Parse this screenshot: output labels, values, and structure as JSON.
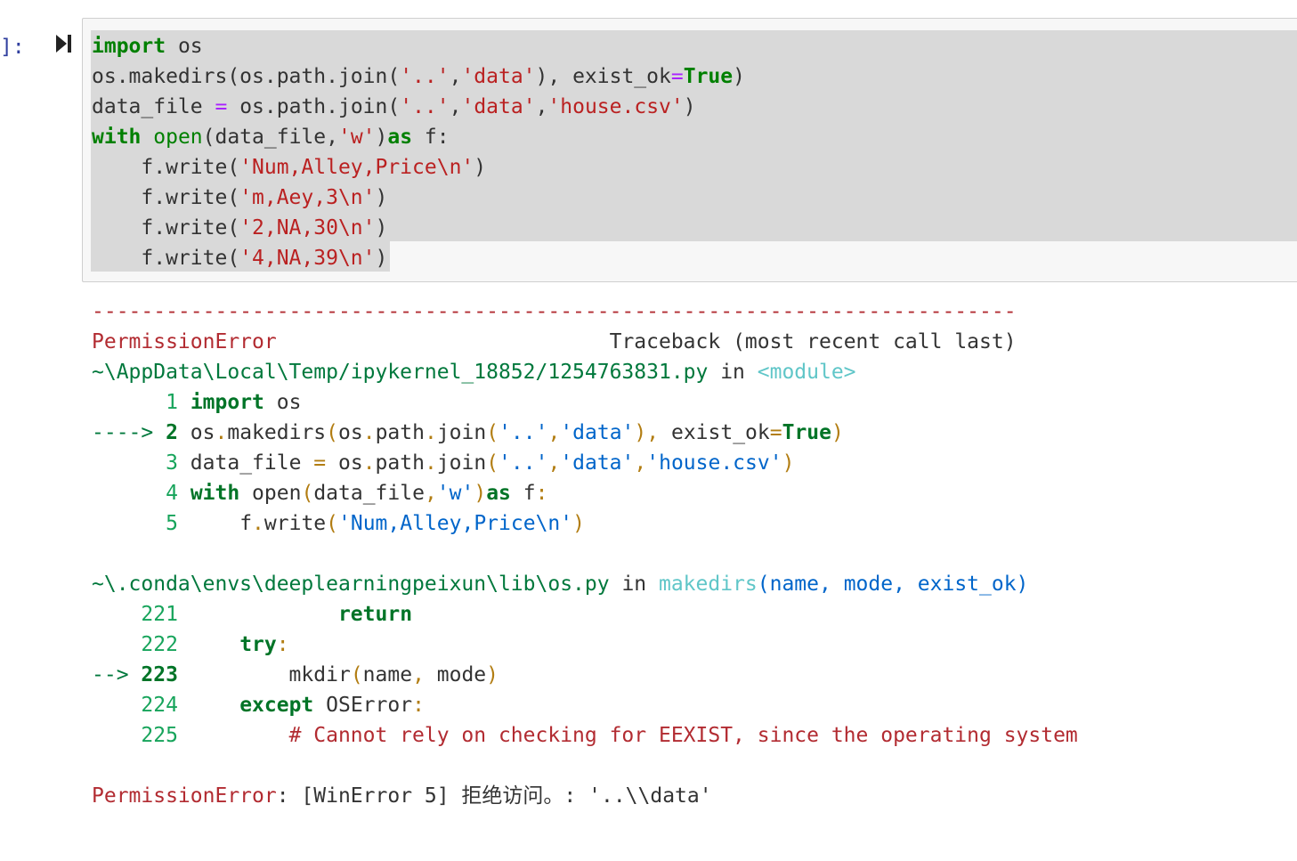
{
  "cell": {
    "prompt": "]:",
    "run_icon": "run-cell-icon"
  },
  "code_lines": [
    "import os",
    "os.makedirs(os.path.join('..','data'), exist_ok=True)",
    "data_file = os.path.join('..','data','house.csv')",
    "with open(data_file,'w')as f:",
    "    f.write('Num,Alley,Price\\n')",
    "    f.write('m,Aey,3\\n')",
    "    f.write('2,NA,30\\n')",
    "    f.write('4,NA,39\\n')"
  ],
  "traceback": {
    "separator": "---------------------------------------------------------------------------",
    "error_name": "PermissionError",
    "header_right": "Traceback (most recent call last)",
    "frames": [
      {
        "path": "~\\AppData\\Local\\Temp/ipykernel_18852/1254763831.py",
        "in_word": " in ",
        "func": "<module>",
        "args": "",
        "lines": [
          {
            "marker": "      ",
            "num": "1",
            "code": " import os"
          },
          {
            "marker": "----> ",
            "num": "2",
            "code": " os.makedirs(os.path.join('..','data'), exist_ok=True)"
          },
          {
            "marker": "      ",
            "num": "3",
            "code": " data_file = os.path.join('..','data','house.csv')"
          },
          {
            "marker": "      ",
            "num": "4",
            "code": " with open(data_file,'w')as f:"
          },
          {
            "marker": "      ",
            "num": "5",
            "code": "     f.write('Num,Alley,Price\\n')"
          }
        ]
      },
      {
        "path": "~\\.conda\\envs\\deeplearningpeixun\\lib\\os.py",
        "in_word": " in ",
        "func": "makedirs",
        "args": "(name, mode, exist_ok)",
        "lines": [
          {
            "marker": "    ",
            "num": "221",
            "code": "             return"
          },
          {
            "marker": "    ",
            "num": "222",
            "code": "     try:"
          },
          {
            "marker": "--> ",
            "num": "223",
            "code": "         mkdir(name, mode)"
          },
          {
            "marker": "    ",
            "num": "224",
            "code": "     except OSError:"
          },
          {
            "marker": "    ",
            "num": "225",
            "code": "         # Cannot rely on checking for EEXIST, since the operating system"
          }
        ]
      }
    ],
    "final_error_name": "PermissionError",
    "final_message": ": [WinError 5] 拒绝访问。: '..\\\\data'"
  }
}
